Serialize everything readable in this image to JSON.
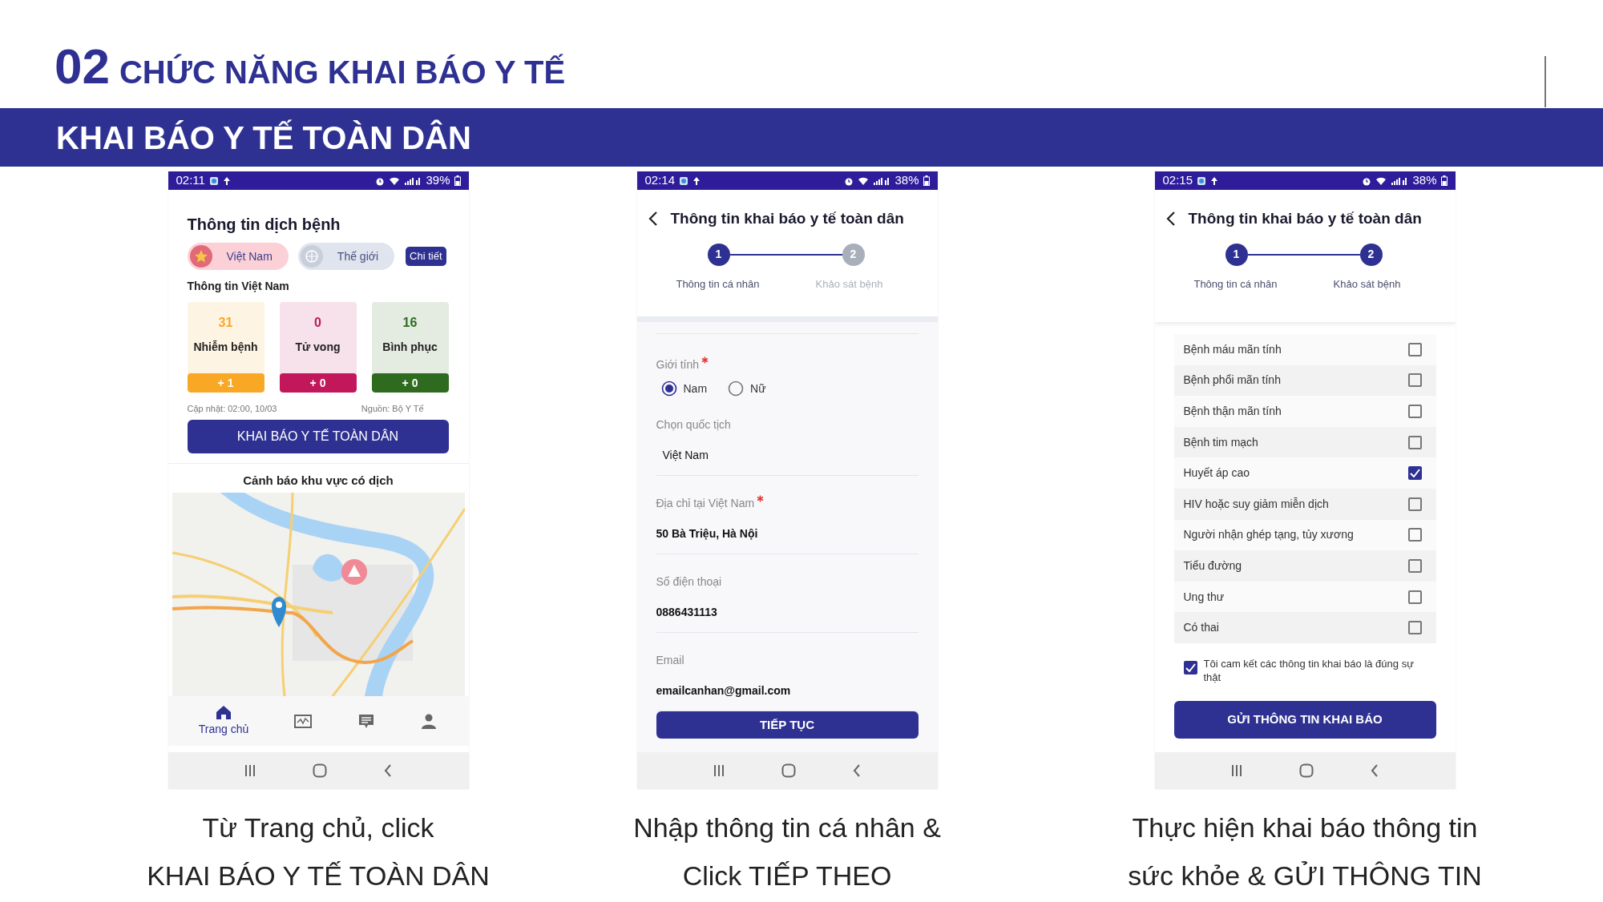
{
  "slide": {
    "number": "02",
    "heading": "CHỨC NĂNG KHAI BÁO Y TẾ",
    "banner": "KHAI BÁO Y TẾ TOÀN DÂN"
  },
  "screens": [
    {
      "kind": "home",
      "status_bar": {
        "time": "02:11",
        "battery": "39%"
      },
      "title": "Thông tin dịch bệnh",
      "region_tabs": [
        {
          "label": "Việt Nam",
          "kind": "flag",
          "selected": true
        },
        {
          "label": "Thế giới",
          "kind": "globe",
          "selected": false
        }
      ],
      "detail_button": "Chi tiết",
      "section_title": "Thông tin Việt Nam",
      "stats": [
        {
          "value": "31",
          "label": "Nhiễm bệnh",
          "change": "+ 1",
          "color": "#f9a825"
        },
        {
          "value": "0",
          "label": "Tử vong",
          "change": "+ 0",
          "color": "#c2185b"
        },
        {
          "value": "16",
          "label": "Bình phục",
          "change": "+ 0",
          "color": "#2e6b1f"
        }
      ],
      "updated": "Cập nhật: 02:00, 10/03",
      "source": "Nguồn: Bộ Y Tế",
      "cta_button": "KHAI BÁO Y TẾ TOÀN DÂN",
      "map_title": "Cảnh báo khu vực có dịch",
      "map": {
        "kind": "picture"
      },
      "bottom_nav": [
        {
          "kind": "home",
          "label": "Trang chủ",
          "selected": true
        },
        {
          "kind": "chart",
          "selected": false
        },
        {
          "kind": "chat",
          "selected": false
        },
        {
          "kind": "user",
          "selected": false
        }
      ],
      "caption": [
        "Từ Trang chủ, click",
        "KHAI BÁO Y TẾ TOÀN DÂN"
      ]
    },
    {
      "kind": "form",
      "status_bar": {
        "time": "02:14",
        "battery": "38%"
      },
      "title": "Thông tin khai báo y tế toàn dân",
      "steps": [
        {
          "number": "1",
          "label": "Thông tin cá nhân",
          "active": true
        },
        {
          "number": "2",
          "label": "Khảo sát bệnh",
          "active": false
        }
      ],
      "fields": [
        {
          "kind": "radio",
          "label": "Giới tính",
          "required": true,
          "options": [
            {
              "label": "Nam",
              "selected": true
            },
            {
              "label": "Nữ",
              "selected": false
            }
          ]
        },
        {
          "kind": "select",
          "label": "Chọn quốc tịch",
          "required": false,
          "value": "Việt Nam"
        },
        {
          "kind": "text",
          "label": "Địa chỉ tại Việt Nam",
          "required": true,
          "value": "50 Bà Triệu, Hà Nội"
        },
        {
          "kind": "text",
          "label": "Số điện thoại",
          "required": false,
          "value": "0886431113"
        },
        {
          "kind": "text",
          "label": "Email",
          "required": false,
          "value": "emailcanhan@gmail.com"
        }
      ],
      "button": "TIẾP TỤC",
      "caption": [
        "Nhập thông tin cá nhân &",
        "Click TIẾP THEO"
      ]
    },
    {
      "kind": "survey",
      "status_bar": {
        "time": "02:15",
        "battery": "38%"
      },
      "title": "Thông tin khai báo y tế toàn dân",
      "steps": [
        {
          "number": "1",
          "label": "Thông tin cá nhân",
          "active": true
        },
        {
          "number": "2",
          "label": "Khảo sát bệnh",
          "active": true
        }
      ],
      "conditions": [
        {
          "label": "Bệnh máu mãn tính",
          "checked": false
        },
        {
          "label": "Bệnh phổi mãn tính",
          "checked": false
        },
        {
          "label": "Bệnh thận mãn tính",
          "checked": false
        },
        {
          "label": "Bệnh tim mạch",
          "checked": false
        },
        {
          "label": "Huyết áp cao",
          "checked": true
        },
        {
          "label": "HIV hoặc suy giảm miễn dịch",
          "checked": false
        },
        {
          "label": "Người nhận ghép tạng, tủy xương",
          "checked": false
        },
        {
          "label": "Tiểu đường",
          "checked": false
        },
        {
          "label": "Ung thư",
          "checked": false
        },
        {
          "label": "Có thai",
          "checked": false
        }
      ],
      "commitment": {
        "text": "Tôi cam kết các thông tin khai báo là đúng sự thật",
        "checked": true
      },
      "button": "GỬI THÔNG TIN KHAI BÁO",
      "caption": [
        "Thực hiện khai báo thông tin",
        "sức khỏe & GỬI THÔNG TIN"
      ]
    }
  ]
}
